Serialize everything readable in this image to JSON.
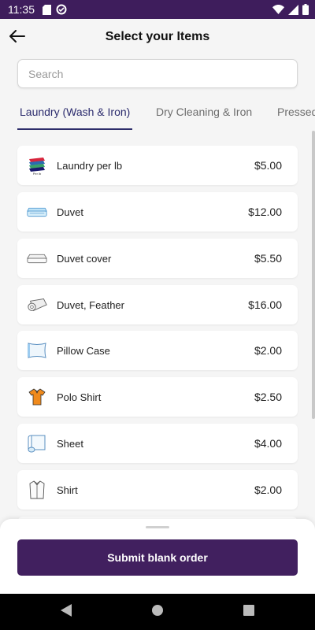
{
  "status_bar": {
    "time": "11:35"
  },
  "header": {
    "title": "Select your Items",
    "back_icon": "arrow-left-icon"
  },
  "search": {
    "placeholder": "Search",
    "value": ""
  },
  "tabs": [
    {
      "label": "Laundry (Wash & Iron)",
      "active": true
    },
    {
      "label": "Dry Cleaning & Iron",
      "active": false
    },
    {
      "label": "Pressed",
      "active": false
    }
  ],
  "items": [
    {
      "name": "Laundry per lb",
      "price": "$5.00",
      "icon": "laundry-pile-icon"
    },
    {
      "name": "Duvet",
      "price": "$12.00",
      "icon": "duvet-icon"
    },
    {
      "name": "Duvet cover",
      "price": "$5.50",
      "icon": "duvet-cover-icon"
    },
    {
      "name": "Duvet, Feather",
      "price": "$16.00",
      "icon": "duvet-feather-icon"
    },
    {
      "name": "Pillow Case",
      "price": "$2.00",
      "icon": "pillow-icon"
    },
    {
      "name": "Polo Shirt",
      "price": "$2.50",
      "icon": "polo-shirt-icon"
    },
    {
      "name": "Sheet",
      "price": "$4.00",
      "icon": "sheet-icon"
    },
    {
      "name": "Shirt",
      "price": "$2.00",
      "icon": "shirt-icon"
    }
  ],
  "bottom": {
    "submit_label": "Submit blank order"
  },
  "colors": {
    "primary": "#41205f",
    "status_bar": "#3e1d5c",
    "tab_active": "#2c2c6e"
  }
}
